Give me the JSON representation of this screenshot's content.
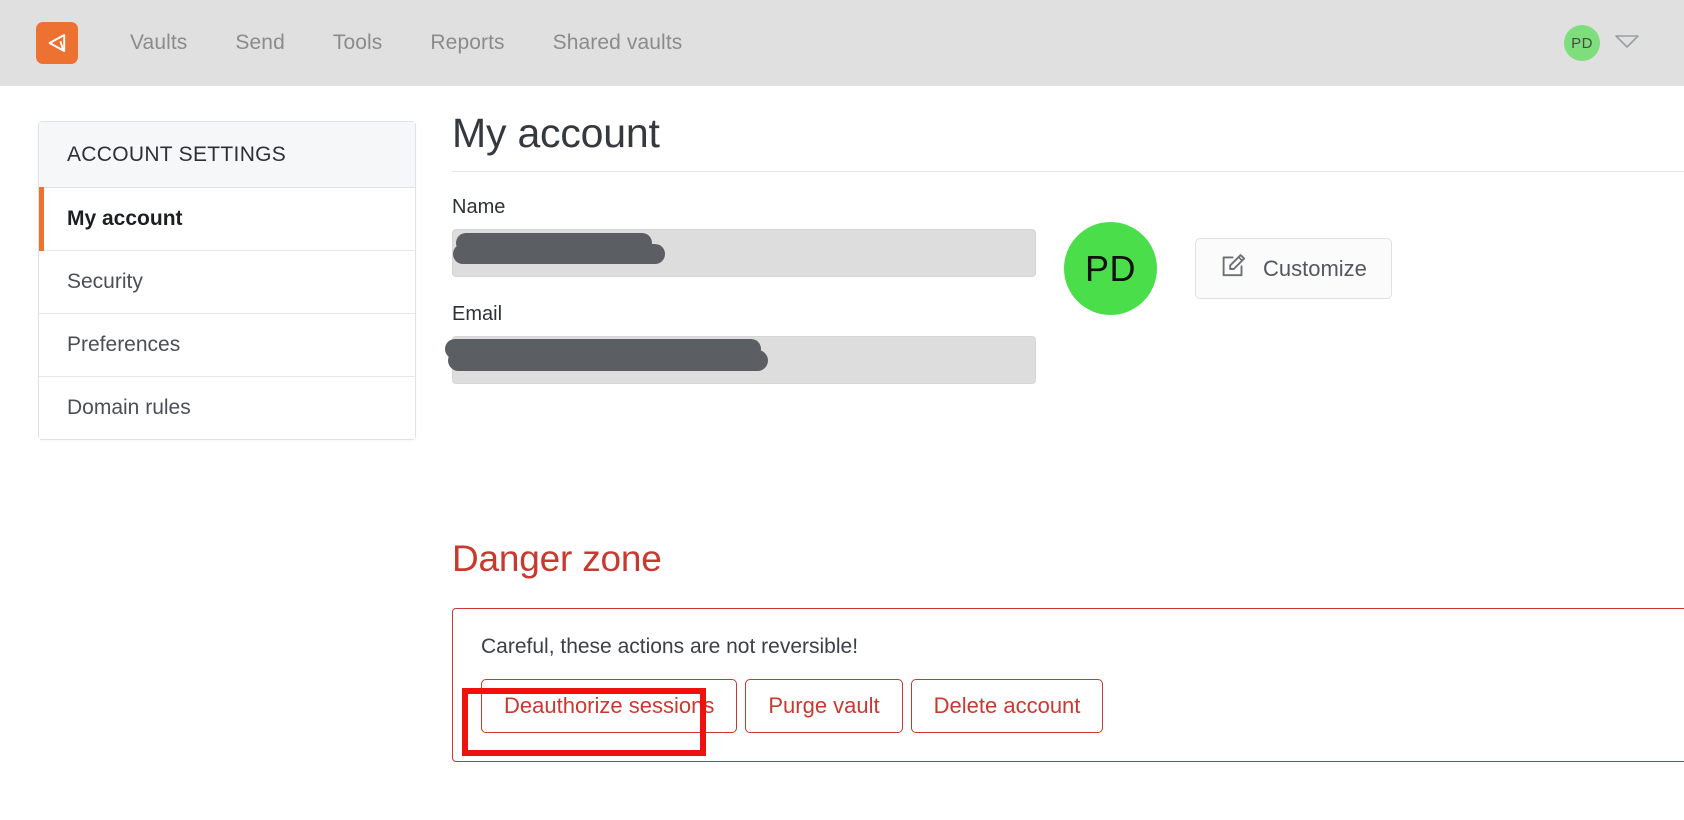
{
  "app": {
    "brand_name": "bitwarden-logo",
    "accent_orange": "#ed7130",
    "danger_red": "#c9392f",
    "annotation_red": "#ee1111",
    "avatar_green": "#4ade4b"
  },
  "topnav": {
    "logo_icon": "shield-logo-icon",
    "links": [
      {
        "label": "Vaults",
        "name": "nav-link-vaults"
      },
      {
        "label": "Send",
        "name": "nav-link-send"
      },
      {
        "label": "Tools",
        "name": "nav-link-tools"
      },
      {
        "label": "Reports",
        "name": "nav-link-reports"
      },
      {
        "label": "Shared vaults",
        "name": "nav-link-shared-vaults"
      }
    ],
    "account": {
      "initials": "PD",
      "chevron_icon": "chevron-down-icon"
    }
  },
  "sidebar": {
    "header": "ACCOUNT SETTINGS",
    "items": [
      {
        "label": "My account",
        "active": true
      },
      {
        "label": "Security",
        "active": false
      },
      {
        "label": "Preferences",
        "active": false
      },
      {
        "label": "Domain rules",
        "active": false
      }
    ]
  },
  "main": {
    "page_title": "My account",
    "fields": [
      {
        "label": "Name",
        "value": "",
        "redacted": true
      },
      {
        "label": "Email",
        "value": "",
        "redacted": true
      }
    ],
    "avatar": {
      "initials": "PD"
    },
    "customize_button": {
      "label": "Customize",
      "icon": "pencil-square-icon"
    }
  },
  "danger_zone": {
    "title": "Danger zone",
    "note": "Careful, these actions are not reversible!",
    "buttons": [
      {
        "label": "Deauthorize sessions",
        "name": "deauthorize-sessions-button",
        "highlighted": true
      },
      {
        "label": "Purge vault",
        "name": "purge-vault-button",
        "highlighted": false
      },
      {
        "label": "Delete account",
        "name": "delete-account-button",
        "highlighted": false
      }
    ]
  }
}
